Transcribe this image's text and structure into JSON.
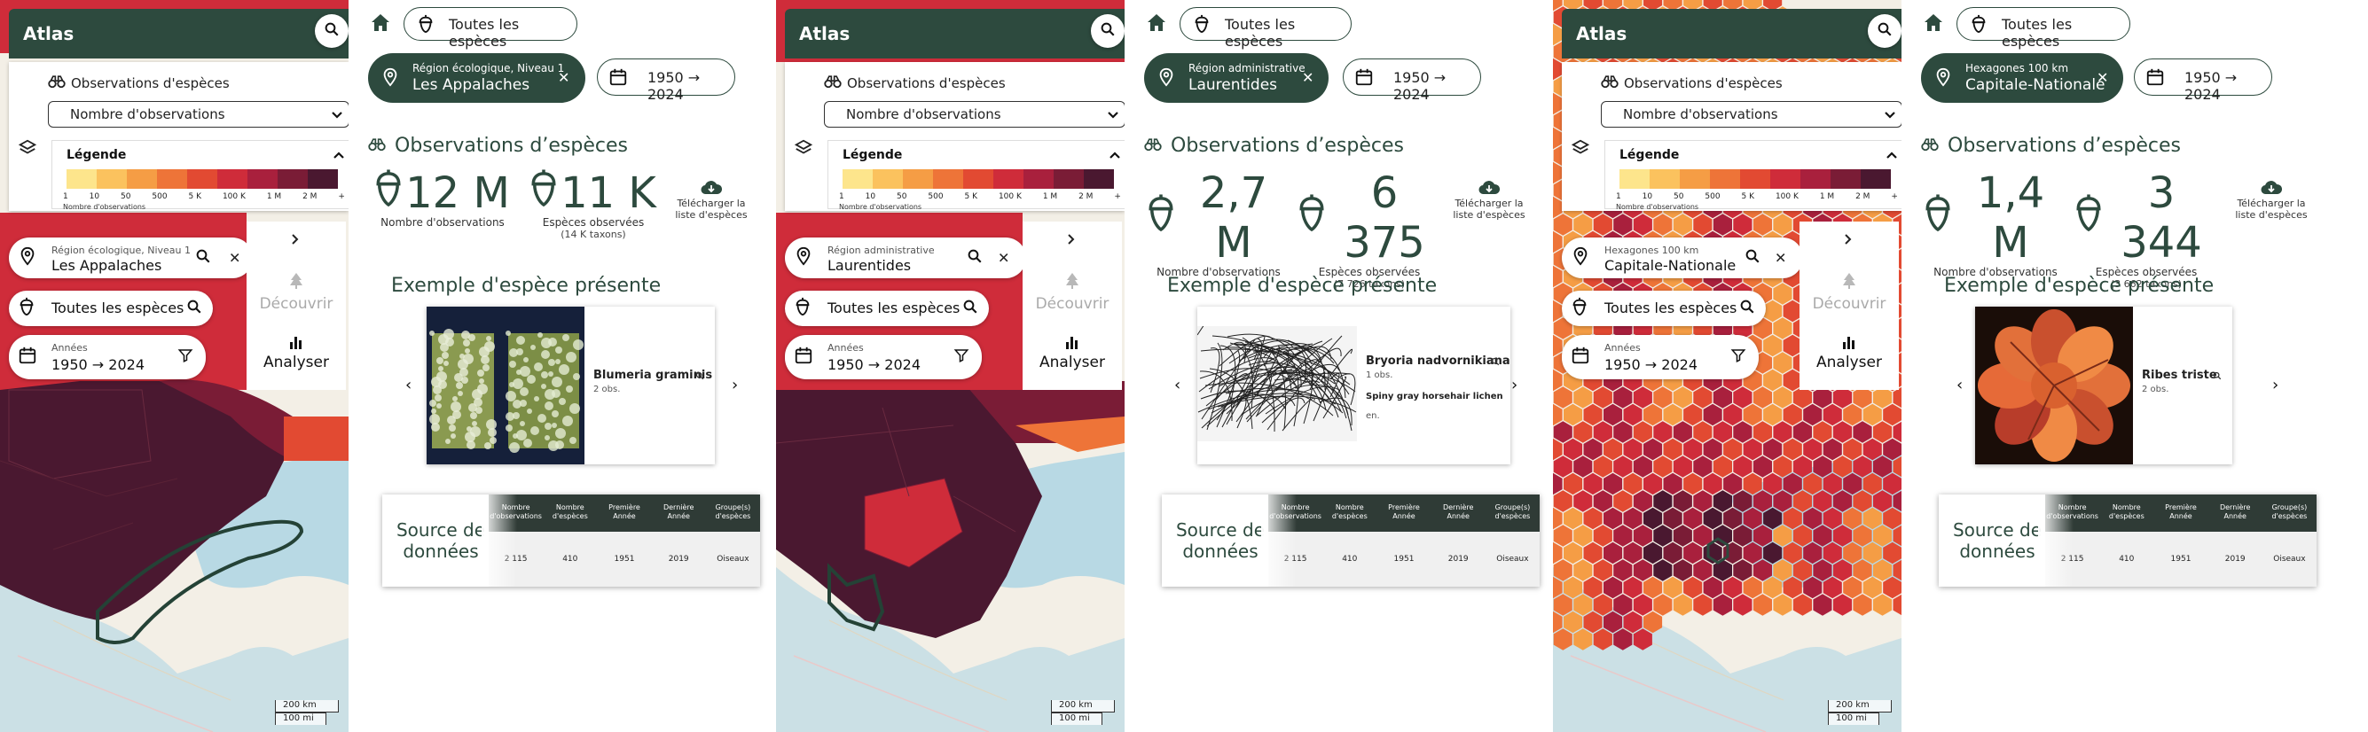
{
  "colors": {
    "brand": "#2d4a3e",
    "ramp": [
      "#fde58c",
      "#fbc25e",
      "#f59d45",
      "#ee7438",
      "#e24a32",
      "#cf2c3a",
      "#a9203d",
      "#7a1c36",
      "#4a1830"
    ]
  },
  "app": {
    "title": "Atlas",
    "control_title": "Observations d'espèces",
    "metric_select": "Nombre d'observations",
    "legend_title": "Légende",
    "legend_ticks": [
      "1",
      "10",
      "50",
      "500",
      "5 K",
      "100 K",
      "1 M",
      "2 M",
      "+"
    ],
    "legend_note": "Nombre d'observations",
    "all_species": "Toutes les espèces",
    "years_label": "Années",
    "years_value": "1950 → 2024",
    "decouvrir": "Découvrir",
    "analyser": "Analyser",
    "scale_km": "200 km",
    "scale_mi": "100 mi",
    "obs_title": "Observations d’espèces",
    "obs_count_label": "Nombre d'observations",
    "species_label": "Espèces observées",
    "download_line1": "Télécharger la",
    "download_line2": "liste d'espèces",
    "example_title": "Exemple d'espèce présente",
    "source_title_1": "Source de",
    "source_title_2": "données",
    "table_headers": [
      "Nombre d'observations",
      "Nombre d'espèces",
      "Première Année",
      "Dernière Année",
      "Groupe(s) d'espèces"
    ]
  },
  "panels": [
    {
      "region_type": "Région écologique, Niveau 1",
      "region_name": "Les Appalaches",
      "obs_count": "12 M",
      "species_count": "11 K",
      "taxa": "(14 K taxons)",
      "species_name": "Blumeria graminis",
      "species_obs": "2 obs.",
      "species_common": "",
      "row": [
        "2 115",
        "410",
        "1951",
        "2019",
        "Oiseaux"
      ]
    },
    {
      "region_type": "Région administrative",
      "region_name": "Laurentides",
      "obs_count": "2,7 M",
      "species_count": "6 375",
      "taxa": "(7 726 taxons)",
      "species_name": "Bryoria nadvornikiana",
      "species_obs": "1 obs.",
      "species_common": "Spiny gray horsehair lichen",
      "species_extra": "en.",
      "row": [
        "2 115",
        "410",
        "1951",
        "2019",
        "Oiseaux"
      ]
    },
    {
      "region_type": "Hexagones 100 km",
      "region_name": "Capitale-Nationale",
      "obs_count": "1,4 M",
      "species_count": "3 344",
      "taxa": "(3 662 taxons)",
      "species_name": "Ribes triste",
      "species_obs": "2 obs.",
      "species_common": "",
      "row": [
        "2 115",
        "410",
        "1951",
        "2019",
        "Oiseaux"
      ]
    }
  ]
}
